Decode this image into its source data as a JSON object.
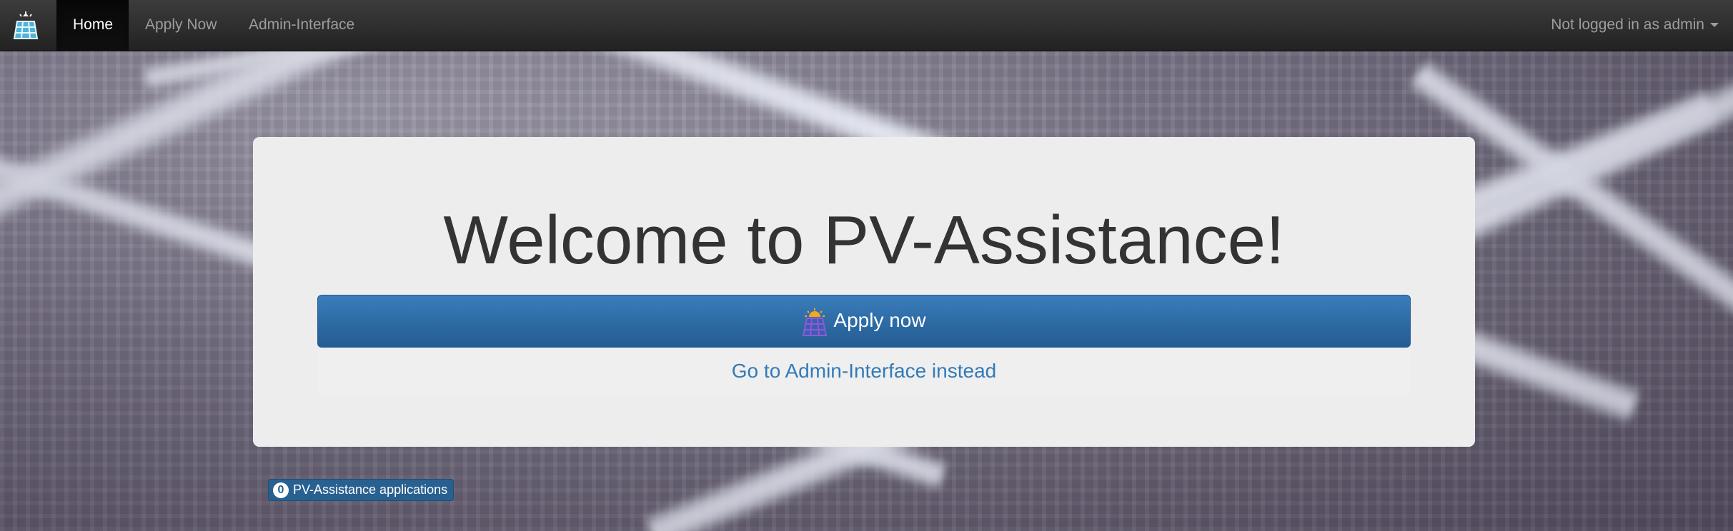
{
  "navbar": {
    "brand_icon": "solar-house-icon",
    "items": [
      {
        "label": "Home",
        "active": true
      },
      {
        "label": "Apply Now",
        "active": false
      },
      {
        "label": "Admin-Interface",
        "active": false
      }
    ],
    "user_menu": {
      "label": "Not logged in as admin",
      "icon": "caret-down-icon"
    }
  },
  "main": {
    "title": "Welcome to PV-Assistance!",
    "apply_button": {
      "label": "Apply now",
      "icon": "solar-panel-icon"
    },
    "admin_link": "Go to Admin-Interface instead"
  },
  "status": {
    "count": "0",
    "label": "PV-Assistance applications"
  },
  "colors": {
    "navbar": "#222222",
    "primary": "#337ab7",
    "primary_dark": "#286090",
    "jumbotron": "#eeeeee",
    "nav_text": "#9d9d9d",
    "title_text": "#333333"
  }
}
